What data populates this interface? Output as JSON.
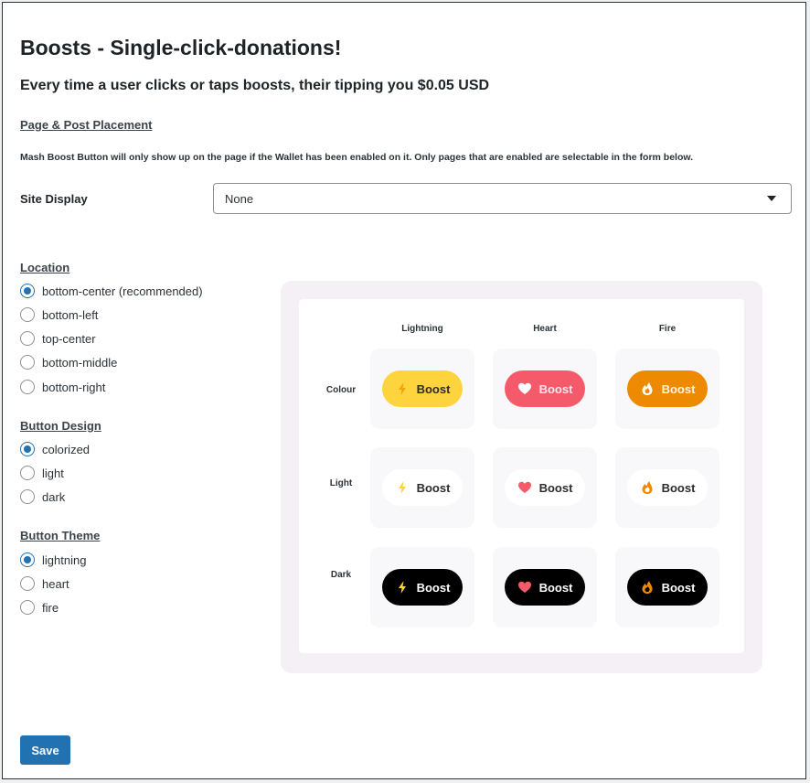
{
  "page": {
    "title": "Boosts - Single-click-donations!",
    "subtitle": "Every time a user clicks or taps boosts, their tipping you $0.05 USD",
    "section_link": "Page & Post Placement",
    "notice": "Mash Boost Button will only show up on the page if the Wallet has been enabled on it. Only pages that are enabled are selectable in the form below."
  },
  "site_display": {
    "label": "Site Display",
    "value": "None"
  },
  "location": {
    "title": "Location",
    "options": [
      "bottom-center (recommended)",
      "bottom-left",
      "top-center",
      "bottom-middle",
      "bottom-right"
    ],
    "selected": "bottom-center (recommended)"
  },
  "button_design": {
    "title": "Button Design",
    "options": [
      "colorized",
      "light",
      "dark"
    ],
    "selected": "colorized"
  },
  "button_theme": {
    "title": "Button Theme",
    "options": [
      "lightning",
      "heart",
      "fire"
    ],
    "selected": "lightning"
  },
  "preview": {
    "columns": [
      "Lightning",
      "Heart",
      "Fire"
    ],
    "rows": [
      "Colour",
      "Light",
      "Dark"
    ],
    "boost_label": "Boost",
    "icons": [
      "lightning-icon",
      "heart-icon",
      "fire-icon"
    ],
    "colors": {
      "lightning_yellow": "#fdd43d",
      "heart_red": "#f55a6a",
      "fire_orange": "#ee8a00",
      "panel_bg": "#f5eff6",
      "dark_pill": "#000000"
    }
  },
  "actions": {
    "save_label": "Save"
  }
}
